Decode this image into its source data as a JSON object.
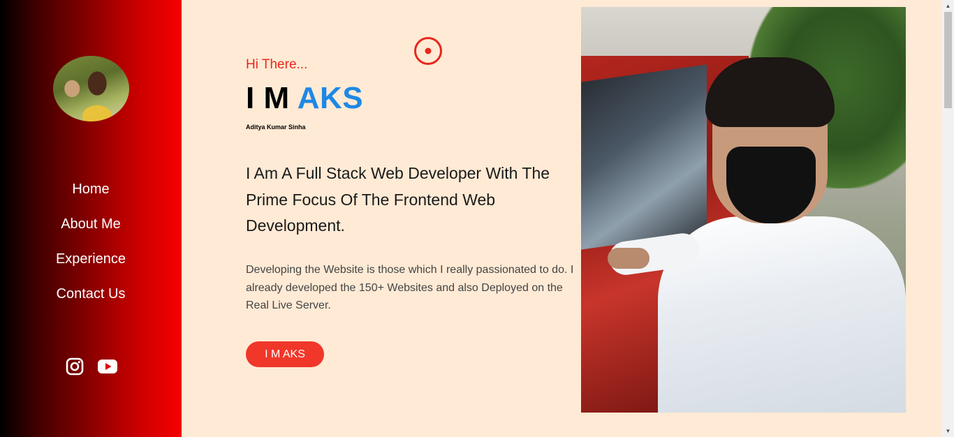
{
  "hero": {
    "greeting": "Hi There...",
    "title_prefix": "I M",
    "title_accent": "AKS",
    "full_name": "Aditya Kumar Sinha",
    "tagline": "I Am A Full Stack Web Developer With The Prime Focus Of The Frontend Web Development.",
    "description": "Developing the Website is those which I really passionated to do. I already developed the 150+ Websites and also Deployed on the Real Live Server.",
    "cta_label": "I M AKS"
  },
  "sidebar": {
    "nav": [
      {
        "label": "Home"
      },
      {
        "label": "About Me"
      },
      {
        "label": "Experience"
      },
      {
        "label": "Contact Us"
      }
    ],
    "social": [
      "instagram-icon",
      "youtube-icon"
    ]
  },
  "colors": {
    "accent_red": "#f0372a",
    "accent_blue": "#1e88e5",
    "background": "#ffead5"
  }
}
